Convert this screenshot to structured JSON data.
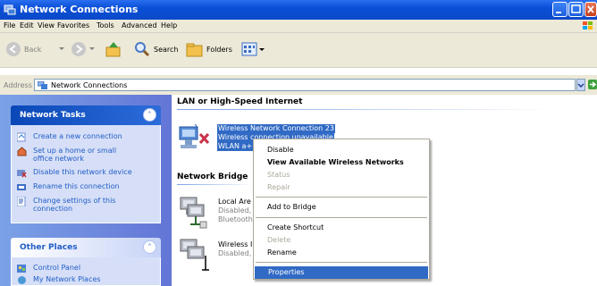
{
  "window": {
    "title": "Network Connections"
  },
  "menubar": {
    "items": [
      "File",
      "Edit",
      "View",
      "Favorites",
      "Tools",
      "Advanced",
      "Help"
    ]
  },
  "toolbar": {
    "back": "Back",
    "search": "Search",
    "folders": "Folders"
  },
  "address": {
    "label": "Address",
    "value": "Network Connections",
    "go": "Go"
  },
  "network_tasks": {
    "title": "Network Tasks",
    "items": [
      "Create a new connection",
      "Set up a home or small office network",
      "Disable this network device",
      "Rename this connection",
      "Change settings of this connection"
    ]
  },
  "other_places": {
    "title": "Other Places",
    "items": [
      "Control Panel",
      "My Network Places"
    ]
  },
  "groups": {
    "lan": "LAN or High-Speed Internet",
    "bridge": "Network Bridge"
  },
  "connections": {
    "wireless_selected": {
      "name": "Wireless Network Connection 23",
      "status": "Wireless connection unavailable",
      "device": "WLAN a+"
    },
    "local_area": {
      "name": "Local Are",
      "status": "Disabled,",
      "device": "Bluetooth"
    },
    "wireless2": {
      "name": "Wireless I",
      "status": "Disabled,"
    }
  },
  "context_menu": {
    "items": [
      {
        "label": "Disable",
        "style": "normal"
      },
      {
        "label": "View Available Wireless Networks",
        "style": "bold"
      },
      {
        "label": "Status",
        "style": "disabled"
      },
      {
        "label": "Repair",
        "style": "disabled"
      },
      {
        "label": "Add to Bridge",
        "style": "normal"
      },
      {
        "label": "Create Shortcut",
        "style": "normal"
      },
      {
        "label": "Delete",
        "style": "disabled"
      },
      {
        "label": "Rename",
        "style": "normal"
      },
      {
        "label": "Properties",
        "style": "highlighted"
      }
    ]
  },
  "colors": {
    "titlebar": "#0b49c9",
    "selection": "#316ac5",
    "link": "#215dc6",
    "left_pane": "#7ba2e7"
  }
}
